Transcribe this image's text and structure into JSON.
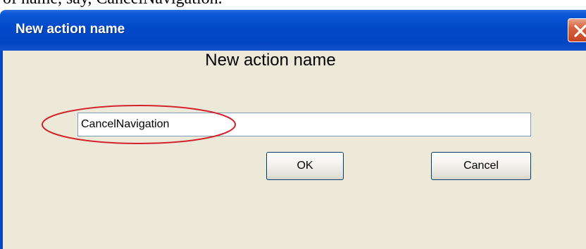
{
  "page_caption": "of name, say, CancelNavigation.",
  "dialog": {
    "title": "New action name",
    "heading": "New action name",
    "input_value": "CancelNavigation",
    "ok_label": "OK",
    "cancel_label": "Cancel"
  },
  "icons": {
    "close": "close-icon",
    "annotation": "red-ellipse-highlight"
  },
  "colors": {
    "titlebar": "#0049c9",
    "client_bg": "#ece9d8",
    "close_button": "#d4623e",
    "highlight": "#d2232a"
  }
}
